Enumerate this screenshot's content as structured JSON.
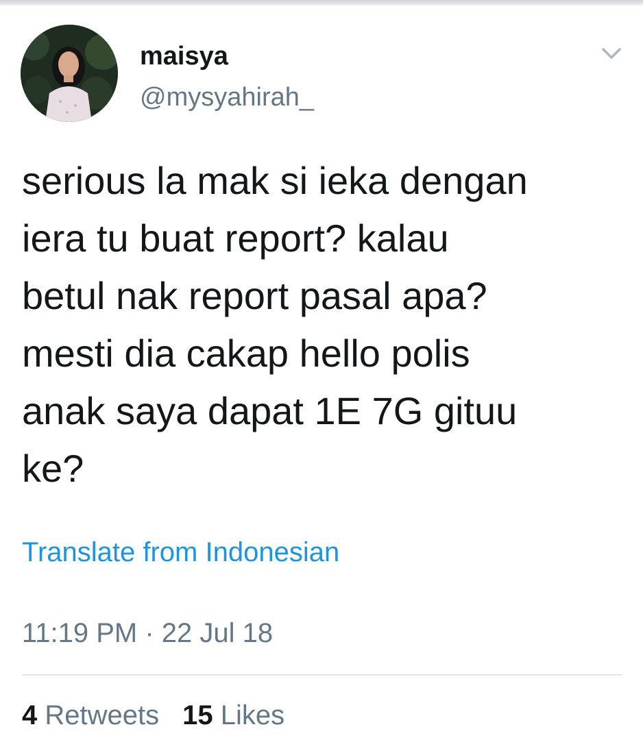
{
  "header": {
    "display_name": "maisya",
    "handle": "@mysyahirah_",
    "menu_icon": "chevron-down-icon",
    "avatar_icon": "profile-photo"
  },
  "tweet": {
    "text": "serious la mak si ieka dengan\niera tu buat report? kalau\nbetul nak report pasal apa?\nmesti dia cakap hello polis\nanak saya dapat 1E 7G gituu\nke?",
    "translate_label": "Translate from Indonesian",
    "timestamp": "11:19 PM · 22 Jul 18"
  },
  "stats": {
    "retweets_count": "4",
    "retweets_label": "Retweets",
    "likes_count": "15",
    "likes_label": "Likes"
  },
  "colors": {
    "link": "#1b95e0",
    "secondary_text": "#657786",
    "primary_text": "#14171a",
    "divider": "#e1e8ed"
  }
}
